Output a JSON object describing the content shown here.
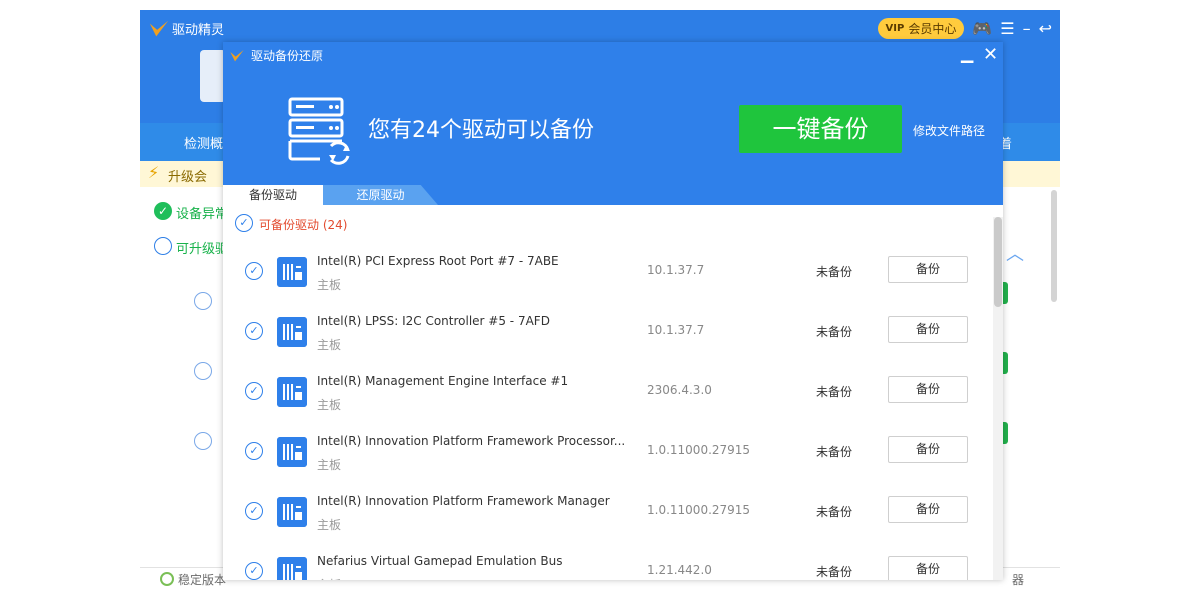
{
  "app": {
    "title": "驱动精灵",
    "vip_center": "会员中心",
    "vip_badge": "VIP",
    "nav_left": "检测概",
    "nav_right": "着",
    "upgrade_text": "升级会",
    "status_ok": "设备异常",
    "status_upgrade": "可升级驱",
    "bottom_left": "稳定版本",
    "bottom_right": "器"
  },
  "modal": {
    "title": "驱动备份还原",
    "headline": "您有24个驱动可以备份",
    "backup_all": "一键备份",
    "change_path": "修改文件路径",
    "tabs": [
      {
        "label": "备份驱动"
      },
      {
        "label": "还原驱动"
      }
    ],
    "section_title": "可备份驱动  (24)",
    "rows": [
      {
        "name": "Intel(R) PCI Express Root Port #7 - 7ABE",
        "category": "主板",
        "version": "10.1.37.7",
        "status": "未备份",
        "action": "备份"
      },
      {
        "name": "Intel(R) LPSS: I2C Controller #5 - 7AFD",
        "category": "主板",
        "version": "10.1.37.7",
        "status": "未备份",
        "action": "备份"
      },
      {
        "name": "Intel(R) Management Engine Interface #1",
        "category": "主板",
        "version": "2306.4.3.0",
        "status": "未备份",
        "action": "备份"
      },
      {
        "name": "Intel(R) Innovation Platform Framework Processor...",
        "category": "主板",
        "version": "1.0.11000.27915",
        "status": "未备份",
        "action": "备份"
      },
      {
        "name": "Intel(R) Innovation Platform Framework Manager",
        "category": "主板",
        "version": "1.0.11000.27915",
        "status": "未备份",
        "action": "备份"
      },
      {
        "name": "Nefarius Virtual Gamepad Emulation Bus",
        "category": "主板",
        "version": "1.21.442.0",
        "status": "未备份",
        "action": "备份"
      }
    ]
  },
  "colors": {
    "primary": "#2f80ea",
    "green_button": "#1fc53d",
    "section_title": "#e34b2f"
  }
}
